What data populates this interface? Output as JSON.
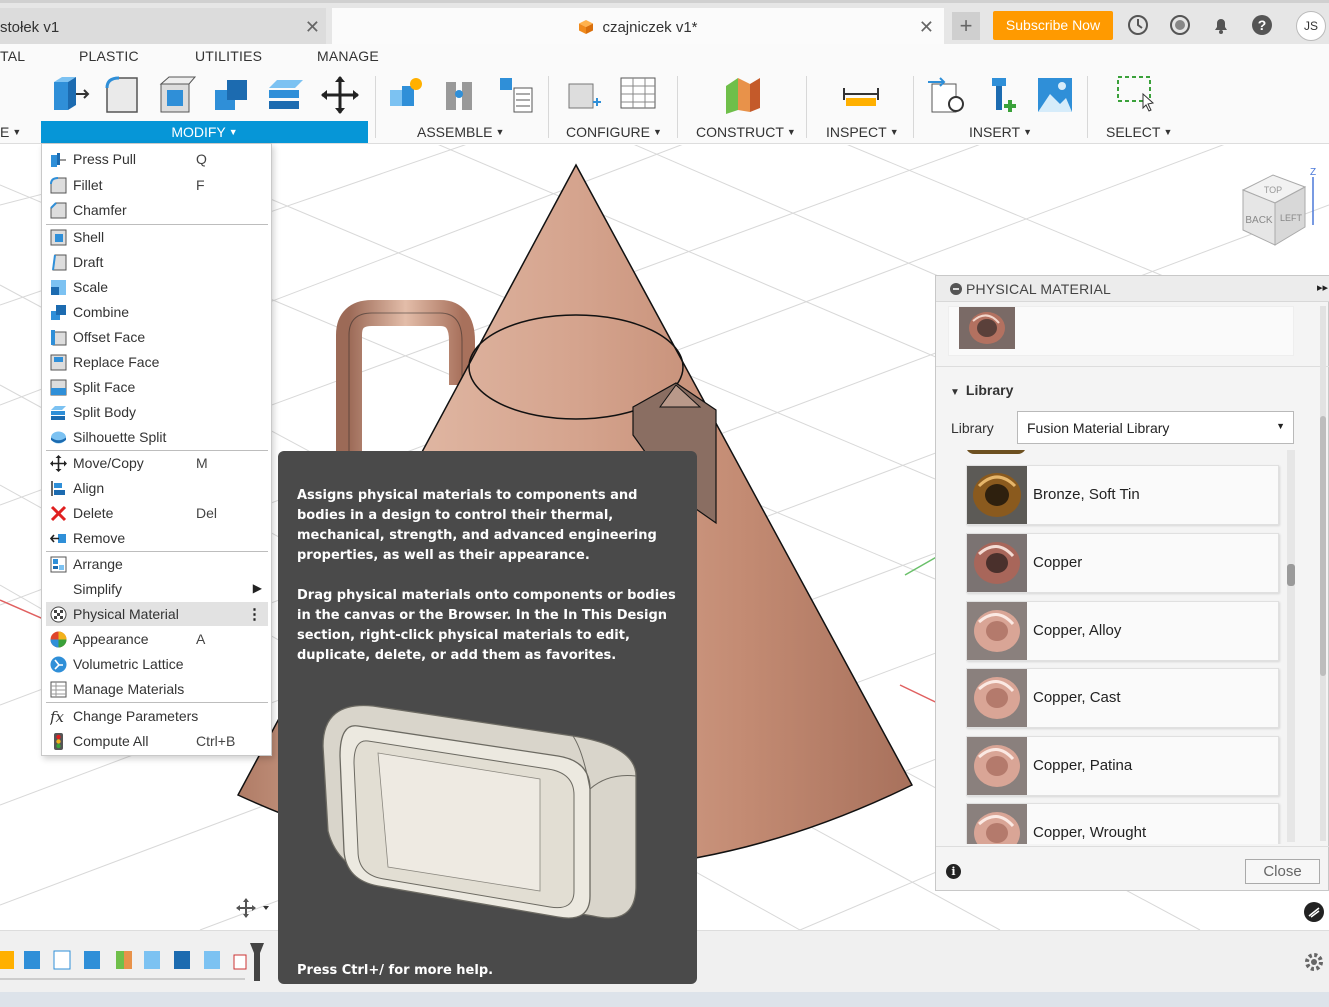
{
  "tabs": {
    "tab1_title": "stołek v1",
    "tab2_title": "czajniczek v1*",
    "close_glyph": "✕",
    "new_tab_glyph": "+"
  },
  "header": {
    "subscribe_label": "Subscribe Now",
    "user_initials": "JS",
    "icons": [
      "clock-icon",
      "history-icon",
      "bell-icon",
      "help-icon"
    ]
  },
  "ribbon": {
    "tabs": [
      "TAL",
      "PLASTIC",
      "UTILITIES",
      "MANAGE"
    ],
    "partial_left_label": "E",
    "groups": {
      "modify": "MODIFY",
      "assemble": "ASSEMBLE",
      "configure": "CONFIGURE",
      "construct": "CONSTRUCT",
      "inspect": "INSPECT",
      "insert": "INSERT",
      "select": "SELECT"
    },
    "dropdown_arrow": "▼"
  },
  "modify_menu": {
    "items": [
      {
        "label": "Press Pull",
        "shortcut": "Q",
        "icon": "press-pull-icon"
      },
      {
        "label": "Fillet",
        "shortcut": "F",
        "icon": "fillet-icon"
      },
      {
        "label": "Chamfer",
        "shortcut": "",
        "icon": "chamfer-icon"
      },
      {
        "label": "Shell",
        "shortcut": "",
        "icon": "shell-icon"
      },
      {
        "label": "Draft",
        "shortcut": "",
        "icon": "draft-icon"
      },
      {
        "label": "Scale",
        "shortcut": "",
        "icon": "scale-icon"
      },
      {
        "label": "Combine",
        "shortcut": "",
        "icon": "combine-icon"
      },
      {
        "label": "Offset Face",
        "shortcut": "",
        "icon": "offset-face-icon"
      },
      {
        "label": "Replace Face",
        "shortcut": "",
        "icon": "replace-face-icon"
      },
      {
        "label": "Split Face",
        "shortcut": "",
        "icon": "split-face-icon"
      },
      {
        "label": "Split Body",
        "shortcut": "",
        "icon": "split-body-icon"
      },
      {
        "label": "Silhouette Split",
        "shortcut": "",
        "icon": "silhouette-split-icon"
      },
      {
        "label": "Move/Copy",
        "shortcut": "M",
        "icon": "move-icon"
      },
      {
        "label": "Align",
        "shortcut": "",
        "icon": "align-icon"
      },
      {
        "label": "Delete",
        "shortcut": "Del",
        "icon": "delete-icon"
      },
      {
        "label": "Remove",
        "shortcut": "",
        "icon": "remove-icon"
      },
      {
        "label": "Arrange",
        "shortcut": "",
        "icon": "arrange-icon"
      },
      {
        "label": "Simplify",
        "shortcut": "",
        "icon": "submenu-arrow-icon"
      },
      {
        "label": "Physical Material",
        "shortcut": "",
        "icon": "physical-material-icon"
      },
      {
        "label": "Appearance",
        "shortcut": "A",
        "icon": "appearance-icon"
      },
      {
        "label": "Volumetric Lattice",
        "shortcut": "",
        "icon": "volumetric-lattice-icon"
      },
      {
        "label": "Manage Materials",
        "shortcut": "",
        "icon": "manage-materials-icon"
      },
      {
        "label": "Change Parameters",
        "shortcut": "",
        "icon": "fx-icon"
      },
      {
        "label": "Compute All",
        "shortcut": "Ctrl+B",
        "icon": "compute-all-icon"
      }
    ],
    "highlighted": "Physical Material",
    "more_glyph": "⋮",
    "submenu_glyph": "▶"
  },
  "tooltip": {
    "para1": "Assigns physical materials to components and bodies in a design to control their thermal, mechanical, strength, and advanced engineering properties, as well as their appearance.",
    "para2": "Drag physical materials onto components or bodies in the canvas or the Browser. In the In This Design section, right-click physical materials to edit, duplicate, delete, or add them as favorites.",
    "footer": "Press Ctrl+/ for more help."
  },
  "material_panel": {
    "title": "PHYSICAL MATERIAL",
    "section_title": "Library",
    "library_label": "Library",
    "library_value": "Fusion Material Library",
    "materials": [
      "Bronze, Soft Tin",
      "Copper",
      "Copper, Alloy",
      "Copper, Cast",
      "Copper, Patina",
      "Copper, Wrought"
    ],
    "close_label": "Close",
    "info_glyph": "i",
    "expand_glyph": "▸▸"
  },
  "viewcube": {
    "top": "TOP",
    "back": "BACK",
    "left": "LEFT",
    "axis_z": "Z"
  },
  "colors": {
    "accent": "#0696d7",
    "subscribe": "#ff9a00",
    "copper": "#c9957f",
    "tooltip_bg": "#4a4a4a"
  }
}
